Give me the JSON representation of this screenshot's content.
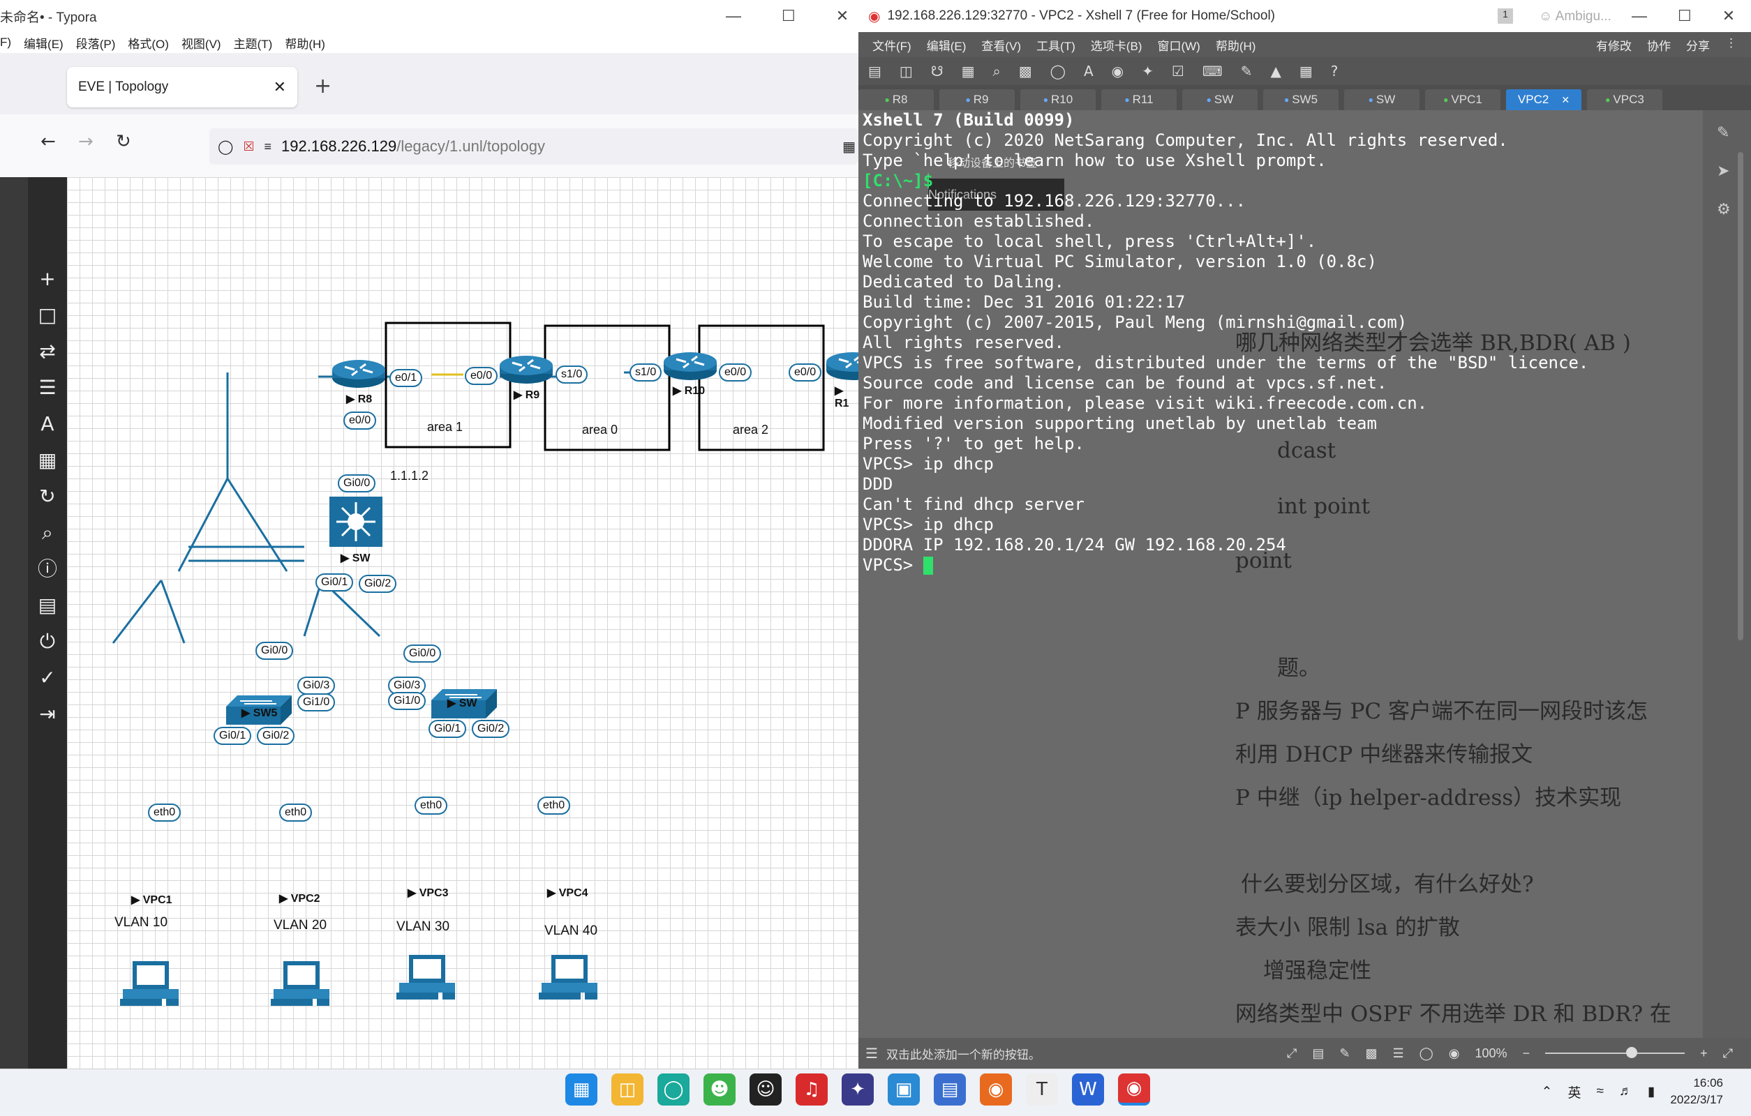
{
  "typora": {
    "title": "未命名• - Typora",
    "menu": [
      "F)",
      "编辑(E)",
      "段落(P)",
      "格式(O)",
      "视图(V)",
      "主题(T)",
      "帮助(H)"
    ]
  },
  "browser": {
    "tab_title": "EVE | Topology",
    "url_host": "192.168.226.129",
    "url_path": "/legacy/1.unl/topology"
  },
  "topology": {
    "areas": [
      "area 1",
      "area 0",
      "area 2"
    ],
    "routers": [
      "R8",
      "R9",
      "R10",
      "R1"
    ],
    "switches": [
      "SW",
      "SW5",
      "SW"
    ],
    "pcs": [
      "VPC1",
      "VPC2",
      "VPC3",
      "VPC4"
    ],
    "vlans": [
      "VLAN 10",
      "VLAN 20",
      "VLAN 30",
      "VLAN 40"
    ],
    "ip_label": "1.1.1.2",
    "ports": {
      "r8_e01": "e0/1",
      "r9_e00": "e0/0",
      "r8_e00": "e0/0",
      "sw_gi00": "Gi0/0",
      "r9_s10": "s1/0",
      "r10_s10": "s1/0",
      "r10_e00": "e0/0",
      "r1_e00": "e0/0",
      "sw_gi01": "Gi0/1",
      "sw_gi02": "Gi0/2",
      "sw5_gi00": "Gi0/0",
      "sw5_gi03": "Gi0/3",
      "sw5_gi10": "Gi1/0",
      "sw5_gi01": "Gi0/1",
      "sw5_gi02": "Gi0/2",
      "sw2_gi00": "Gi0/0",
      "sw2_gi03": "Gi0/3",
      "sw2_gi10": "Gi1/0",
      "sw2_gi01": "Gi0/1",
      "sw2_gi02": "Gi0/2",
      "eth0": "eth0"
    }
  },
  "xshell": {
    "title": "192.168.226.129:32770 - VPC2 - Xshell 7 (Free for Home/School)",
    "ambig": "Ambigu...",
    "menu": [
      "文件(F)",
      "编辑(E)",
      "查看(V)",
      "工具(T)",
      "选项卡(B)",
      "窗口(W)",
      "帮助(H)"
    ],
    "right_actions": [
      "有修改",
      "协作",
      "分享"
    ],
    "tabs": [
      "R8",
      "R9",
      "R10",
      "R11",
      "SW",
      "SW5",
      "SW",
      "VPC1",
      "VPC2",
      "VPC3"
    ],
    "active_tab": "VPC2",
    "notifications": "Notifications",
    "bookmark_hint": "移动设备上的书签",
    "status_hint": "双击此处添加一个新的按钮。",
    "zoom": "100%",
    "terminal_lines": [
      "Xshell 7 (Build 0099)",
      "Copyright (c) 2020 NetSarang Computer, Inc. All rights reserved.",
      "",
      "Type `help' to learn how to use Xshell prompt.",
      "[C:\\~]$",
      "",
      "Connecting to 192.168.226.129:32770...",
      "Connection established.",
      "To escape to local shell, press 'Ctrl+Alt+]'.",
      "",
      "Welcome to Virtual PC Simulator, version 1.0 (0.8c)",
      "Dedicated to Daling.",
      "Build time: Dec 31 2016 01:22:17",
      "Copyright (c) 2007-2015, Paul Meng (mirnshi@gmail.com)",
      "All rights reserved.",
      "",
      "VPCS is free software, distributed under the terms of the \"BSD\" licence.",
      "Source code and license can be found at vpcs.sf.net.",
      "For more information, please visit wiki.freecode.com.cn.",
      "Modified version supporting unetlab by unetlab team",
      "",
      "Press '?' to get help.",
      "",
      "VPCS> ip dhcp",
      "DDD",
      "Can't find dhcp server",
      "",
      "VPCS> ip dhcp",
      "DDORA IP 192.168.20.1/24 GW 192.168.20.254",
      "",
      "VPCS> "
    ],
    "doc_ghost": [
      "哪几种网络类型才会选举 BR,BDR(   AB )",
      "dcast",
      "int point",
      "point",
      "题。",
      "P 服务器与 PC 客户端不在同一网段时该怎",
      "利用 DHCP 中继器来传输报文",
      "P 中继（ip helper-address）技术实现",
      "什么要划分区域，有什么好处?",
      "表大小      限制 lsa 的扩散",
      "增强稳定性",
      "网络类型中 OSPF 不用选举 DR 和 BDR? 在"
    ]
  },
  "taskbar": {
    "ime": "英",
    "time": "16:06",
    "date": "2022/3/17"
  },
  "colors": {
    "cisco_blue": "#1a6fa0",
    "active_tab": "#2f7fd1",
    "serial_link": "#e0c020"
  }
}
